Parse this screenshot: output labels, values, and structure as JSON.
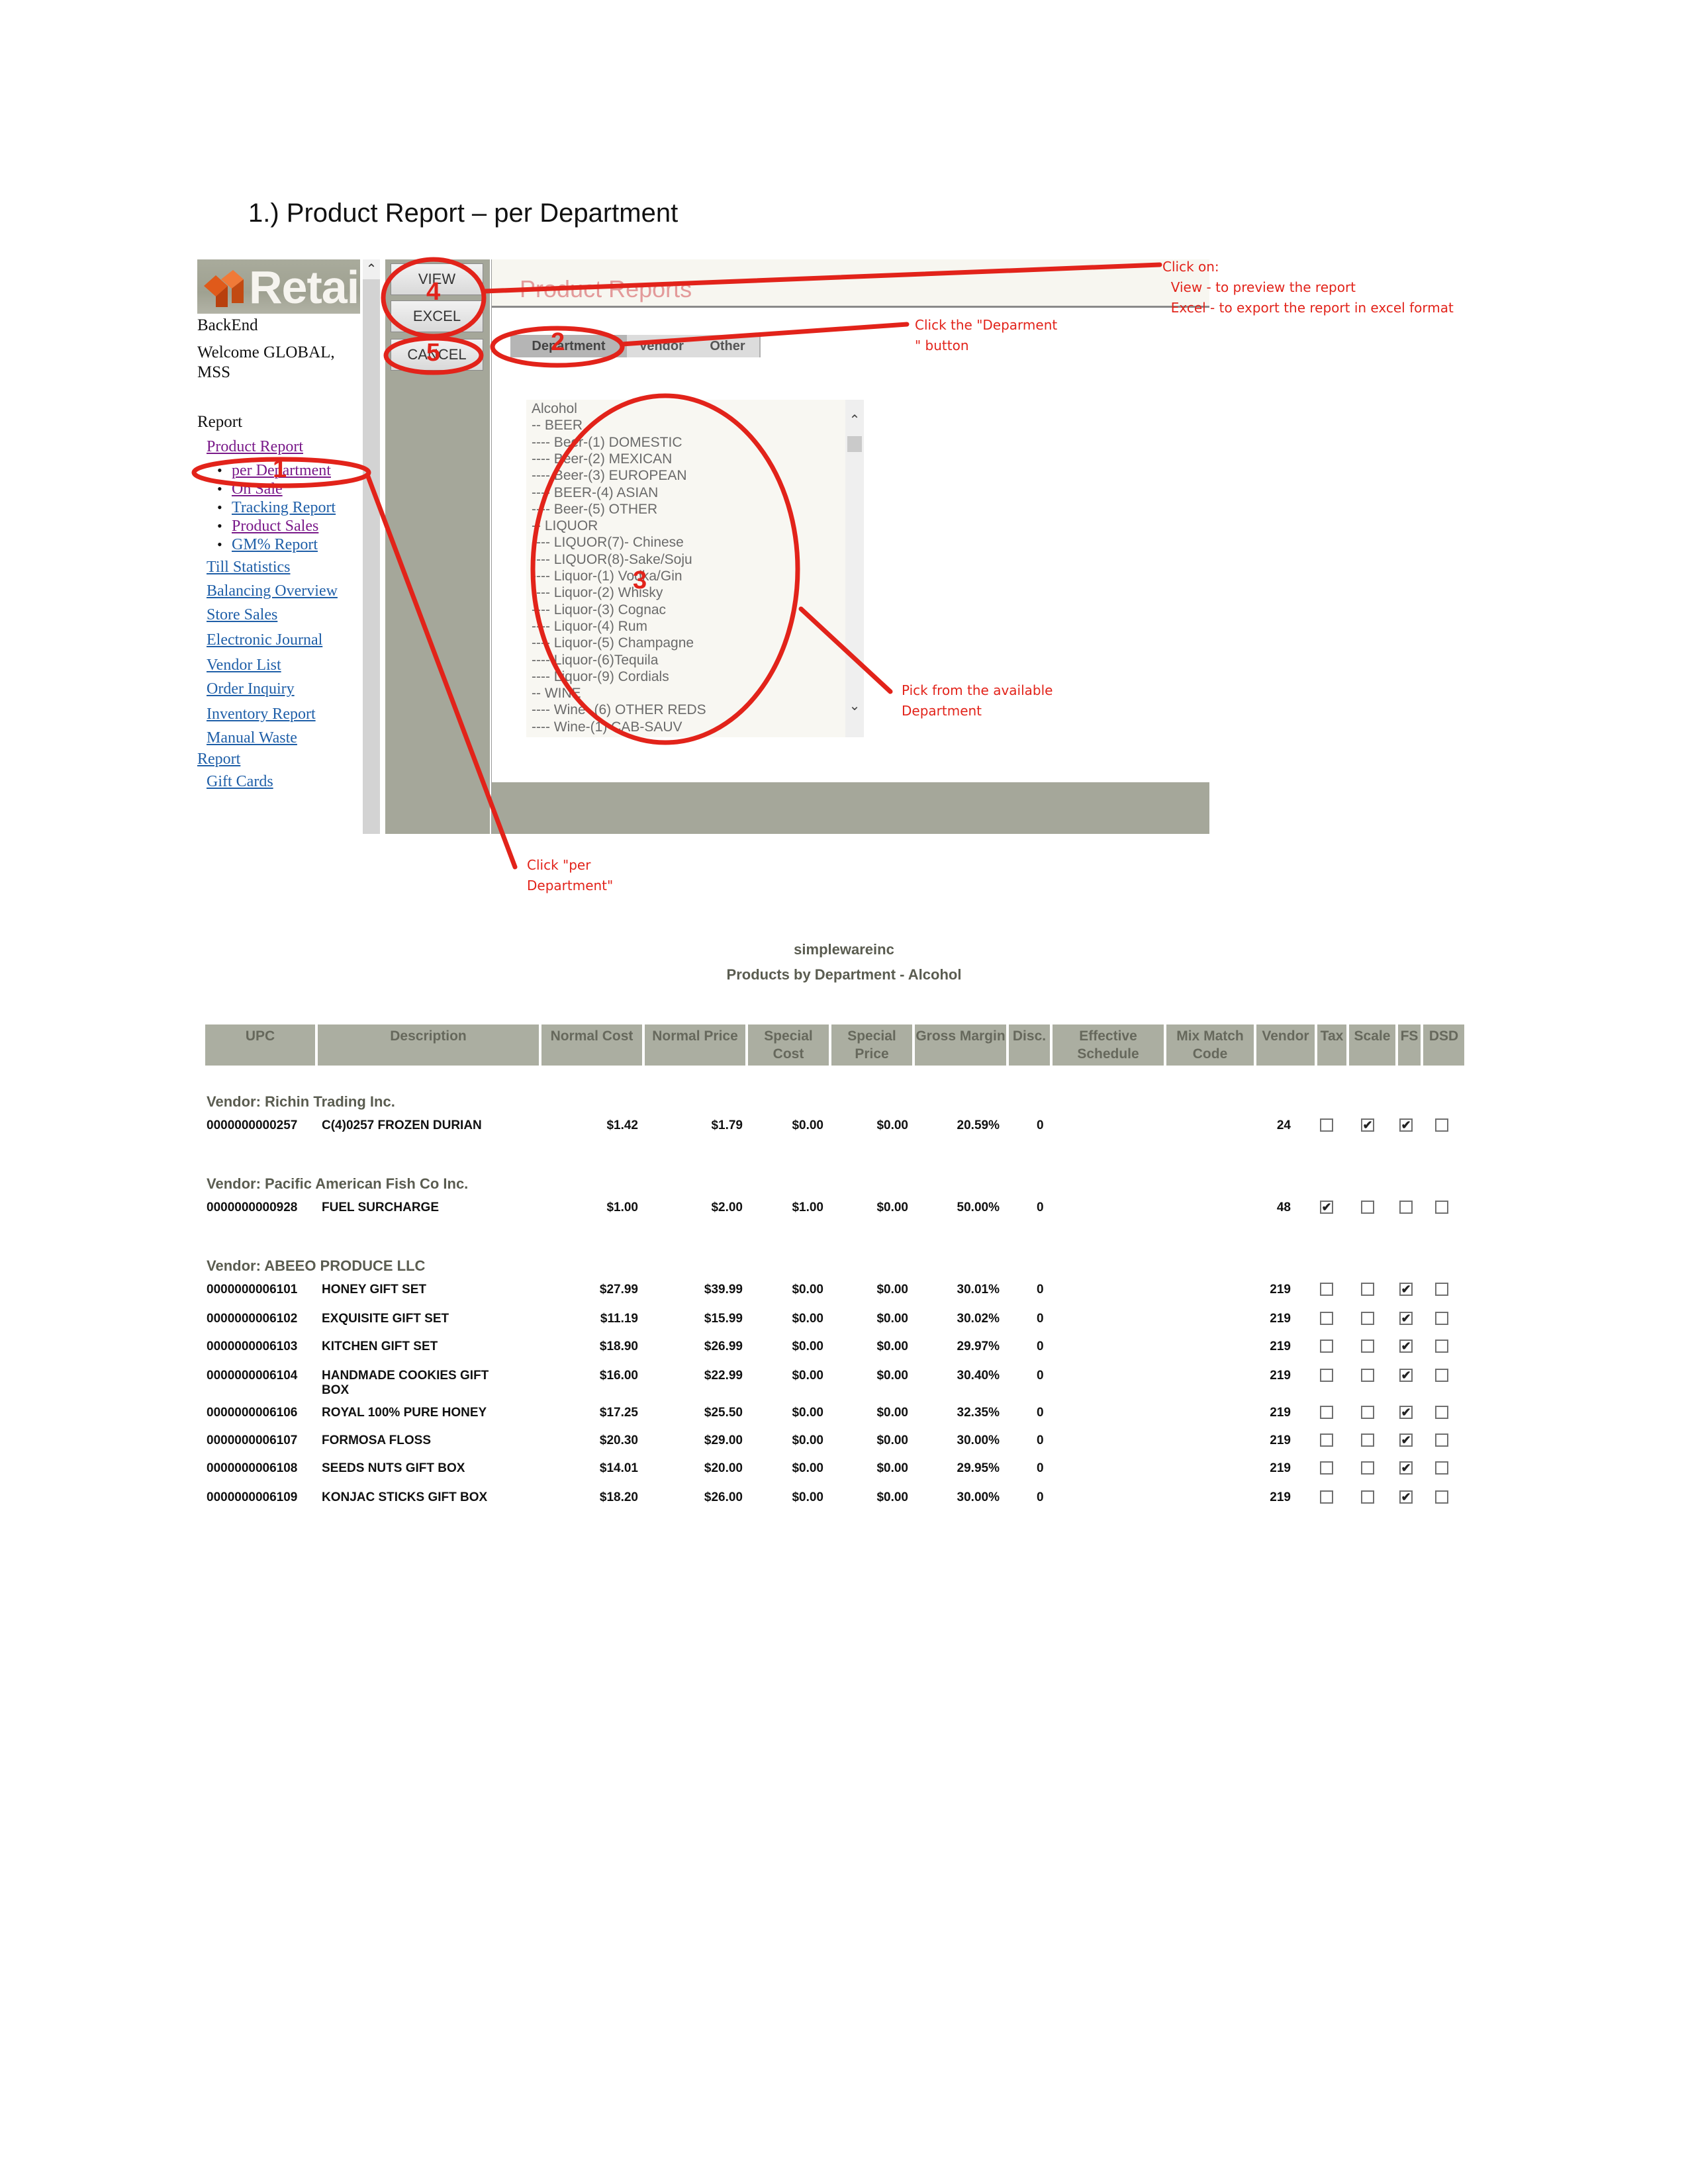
{
  "heading": "1.)  Product Report – per Department",
  "app": {
    "logo_text": "Retail",
    "backend": "BackEnd",
    "welcome": "Welcome GLOBAL, MSS",
    "report_heading": "Report",
    "nav": {
      "product_report": "Product Report",
      "sub_items": [
        "per Department",
        "On Sale",
        "Tracking Report",
        "Product Sales",
        "GM% Report"
      ],
      "items": [
        "Till Statistics",
        "Balancing Overview",
        "Store Sales",
        "Electronic Journal",
        "Vendor List",
        "Order Inquiry",
        "Inventory Report",
        "Manual Waste",
        "Report",
        "Gift Cards"
      ]
    },
    "buttons": {
      "view": "VIEW",
      "excel": "EXCEL",
      "cancel": "CANCEL"
    },
    "content_title": "Product Reports",
    "tabs": [
      "Department",
      "Vendor",
      "Other"
    ],
    "departments": [
      "Alcohol",
      "-- BEER",
      "---- Beer-(1) DOMESTIC",
      "---- Beer-(2) MEXICAN",
      "---- Beer-(3) EUROPEAN",
      "---- BEER-(4) ASIAN",
      "---- Beer-(5) OTHER",
      "-- LIQUOR",
      "---- LIQUOR(7)- Chinese",
      "---- LIQUOR(8)-Sake/Soju",
      "---- Liquor-(1) Vodka/Gin",
      "---- Liquor-(2) Whisky",
      "---- Liquor-(3) Cognac",
      "---- Liquor-(4) Rum",
      "---- Liquor-(5) Champagne",
      "---- Liquor-(6)Tequila",
      "---- Liquor-(9) Cordials",
      "-- WINE",
      "---- Wine- (6) OTHER REDS",
      "---- Wine-(1) CAB-SAUV"
    ]
  },
  "annotations": {
    "view_excel": "Click on:\n  View - to preview the report\n  Excel - to export the report in excel format",
    "department_button": "Click the \"Deparment\n\" button",
    "pick_department": "Pick from the available\nDepartment",
    "per_department": "Click \"per\nDepartment\"",
    "step_numbers": [
      "1",
      "2",
      "3",
      "4",
      "5"
    ],
    "color": "#e2231a"
  },
  "report": {
    "company": "simplewareinc",
    "title": "Products by Department - Alcohol",
    "columns": [
      "UPC",
      "Description",
      "Normal Cost",
      "Normal Price",
      "Special Cost",
      "Special Price",
      "Gross Margin",
      "Disc.",
      "Effective Schedule",
      "Mix Match Code",
      "Vendor",
      "Tax",
      "Scale",
      "FS",
      "DSD"
    ],
    "groups": [
      {
        "vendor": "Vendor: Richin Trading Inc.",
        "rows": [
          {
            "upc": "0000000000257",
            "desc": "C(4)0257 FROZEN DURIAN",
            "ncost": "$1.42",
            "nprice": "$1.79",
            "scost": "$0.00",
            "sprice": "$0.00",
            "gm": "20.59%",
            "disc": "0",
            "vendor": "24",
            "tax": false,
            "scale": true,
            "fs": true,
            "dsd": false
          }
        ]
      },
      {
        "vendor": "Vendor: Pacific American Fish Co Inc.",
        "rows": [
          {
            "upc": "0000000000928",
            "desc": "FUEL SURCHARGE",
            "ncost": "$1.00",
            "nprice": "$2.00",
            "scost": "$1.00",
            "sprice": "$0.00",
            "gm": "50.00%",
            "disc": "0",
            "vendor": "48",
            "tax": true,
            "scale": false,
            "fs": false,
            "dsd": false
          }
        ]
      },
      {
        "vendor": "Vendor: ABEEO PRODUCE LLC",
        "rows": [
          {
            "upc": "0000000006101",
            "desc": "HONEY GIFT SET",
            "ncost": "$27.99",
            "nprice": "$39.99",
            "scost": "$0.00",
            "sprice": "$0.00",
            "gm": "30.01%",
            "disc": "0",
            "vendor": "219",
            "tax": false,
            "scale": false,
            "fs": true,
            "dsd": false
          },
          {
            "upc": "0000000006102",
            "desc": "EXQUISITE GIFT SET",
            "ncost": "$11.19",
            "nprice": "$15.99",
            "scost": "$0.00",
            "sprice": "$0.00",
            "gm": "30.02%",
            "disc": "0",
            "vendor": "219",
            "tax": false,
            "scale": false,
            "fs": true,
            "dsd": false
          },
          {
            "upc": "0000000006103",
            "desc": "KITCHEN GIFT SET",
            "ncost": "$18.90",
            "nprice": "$26.99",
            "scost": "$0.00",
            "sprice": "$0.00",
            "gm": "29.97%",
            "disc": "0",
            "vendor": "219",
            "tax": false,
            "scale": false,
            "fs": true,
            "dsd": false
          },
          {
            "upc": "0000000006104",
            "desc": "HANDMADE COOKIES GIFT BOX",
            "ncost": "$16.00",
            "nprice": "$22.99",
            "scost": "$0.00",
            "sprice": "$0.00",
            "gm": "30.40%",
            "disc": "0",
            "vendor": "219",
            "tax": false,
            "scale": false,
            "fs": true,
            "dsd": false
          },
          {
            "upc": "0000000006106",
            "desc": "ROYAL 100% PURE HONEY",
            "ncost": "$17.25",
            "nprice": "$25.50",
            "scost": "$0.00",
            "sprice": "$0.00",
            "gm": "32.35%",
            "disc": "0",
            "vendor": "219",
            "tax": false,
            "scale": false,
            "fs": true,
            "dsd": false
          },
          {
            "upc": "0000000006107",
            "desc": "FORMOSA FLOSS",
            "ncost": "$20.30",
            "nprice": "$29.00",
            "scost": "$0.00",
            "sprice": "$0.00",
            "gm": "30.00%",
            "disc": "0",
            "vendor": "219",
            "tax": false,
            "scale": false,
            "fs": true,
            "dsd": false
          },
          {
            "upc": "0000000006108",
            "desc": "SEEDS NUTS GIFT BOX",
            "ncost": "$14.01",
            "nprice": "$20.00",
            "scost": "$0.00",
            "sprice": "$0.00",
            "gm": "29.95%",
            "disc": "0",
            "vendor": "219",
            "tax": false,
            "scale": false,
            "fs": true,
            "dsd": false
          },
          {
            "upc": "0000000006109",
            "desc": "KONJAC STICKS GIFT BOX",
            "ncost": "$18.20",
            "nprice": "$26.00",
            "scost": "$0.00",
            "sprice": "$0.00",
            "gm": "30.00%",
            "disc": "0",
            "vendor": "219",
            "tax": false,
            "scale": false,
            "fs": true,
            "dsd": false
          }
        ]
      }
    ]
  }
}
